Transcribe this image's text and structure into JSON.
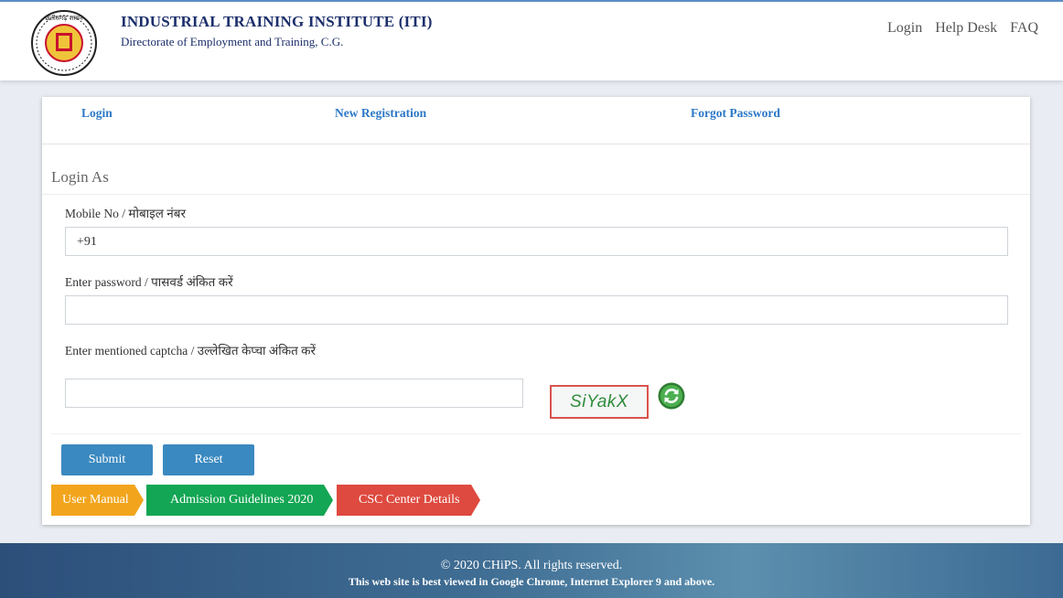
{
  "header": {
    "title": "INDUSTRIAL TRAINING INSTITUTE (ITI)",
    "subtitle": "Directorate of Employment and Training, C.G.",
    "emblem_text": "छत्तीसगढ़ शासन",
    "nav": [
      "Login",
      "Help Desk",
      "FAQ"
    ]
  },
  "tabs": [
    "Login",
    "New Registration",
    "Forgot Password"
  ],
  "form": {
    "heading": "Login As",
    "mobile_label": "Mobile No / मोबाइल नंबर",
    "mobile_value": "+91",
    "password_label": "Enter password / पासवर्ड अंकित करें",
    "password_value": "",
    "captcha_label": "Enter mentioned captcha / उल्लेखित केप्चा अंकित करें",
    "captcha_value": "",
    "captcha_text": "SiYakX",
    "submit_label": "Submit",
    "reset_label": "Reset"
  },
  "links": [
    {
      "label": "User Manual",
      "color": "#f2a51c"
    },
    {
      "label": "Admission Guidelines 2020",
      "color": "#13a654"
    },
    {
      "label": "CSC Center Details",
      "color": "#de4a3f"
    }
  ],
  "footer": {
    "copyright": "© 2020 CHiPS. All rights reserved.",
    "best_viewed": "This web site is best viewed in Google Chrome, Internet Explorer 9 and above."
  }
}
